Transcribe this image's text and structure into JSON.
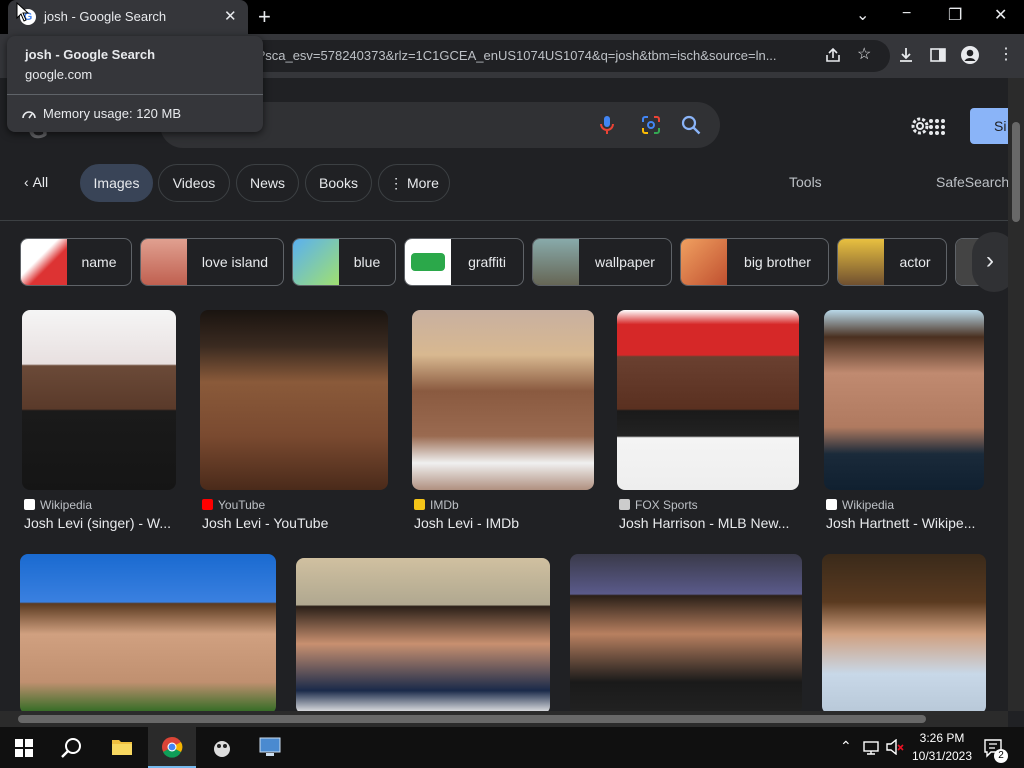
{
  "browser": {
    "tab_title": "josh - Google Search",
    "url_text": "?sca_esv=578240373&rlz=1C1GCEA_enUS1074US1074&q=josh&tbm=isch&source=ln...",
    "new_tab_label": "+",
    "minimize": "−",
    "restore": "❐",
    "close": "✕",
    "tab_close": "✕",
    "chevron": "⌄"
  },
  "tooltip": {
    "title": "josh - Google Search",
    "domain": "google.com",
    "memory": "Memory usage: 120 MB"
  },
  "nav": {
    "back_label": "All",
    "tabs": [
      "Images",
      "Videos",
      "News",
      "Books",
      "More"
    ],
    "tools": "Tools",
    "safesearch": "SafeSearch"
  },
  "signin_label": "Si",
  "related": [
    "name",
    "love island",
    "blue",
    "graffiti",
    "wallpaper",
    "big brother",
    "actor"
  ],
  "results_row1": [
    {
      "source": "Wikipedia",
      "caption": "Josh Levi (singer) - W..."
    },
    {
      "source": "YouTube",
      "caption": "Josh Levi - YouTube"
    },
    {
      "source": "IMDb",
      "caption": "Josh Levi - IMDb"
    },
    {
      "source": "FOX Sports",
      "caption": "Josh Harrison - MLB New..."
    },
    {
      "source": "Wikipedia",
      "caption": "Josh Hartnett - Wikipe..."
    }
  ],
  "taskbar": {
    "time": "3:26 PM",
    "date": "10/31/2023",
    "notifications": "2"
  },
  "colors": {
    "page_bg": "#202124",
    "chip_active": "#394457",
    "signin_blue": "#8ab4f8"
  }
}
